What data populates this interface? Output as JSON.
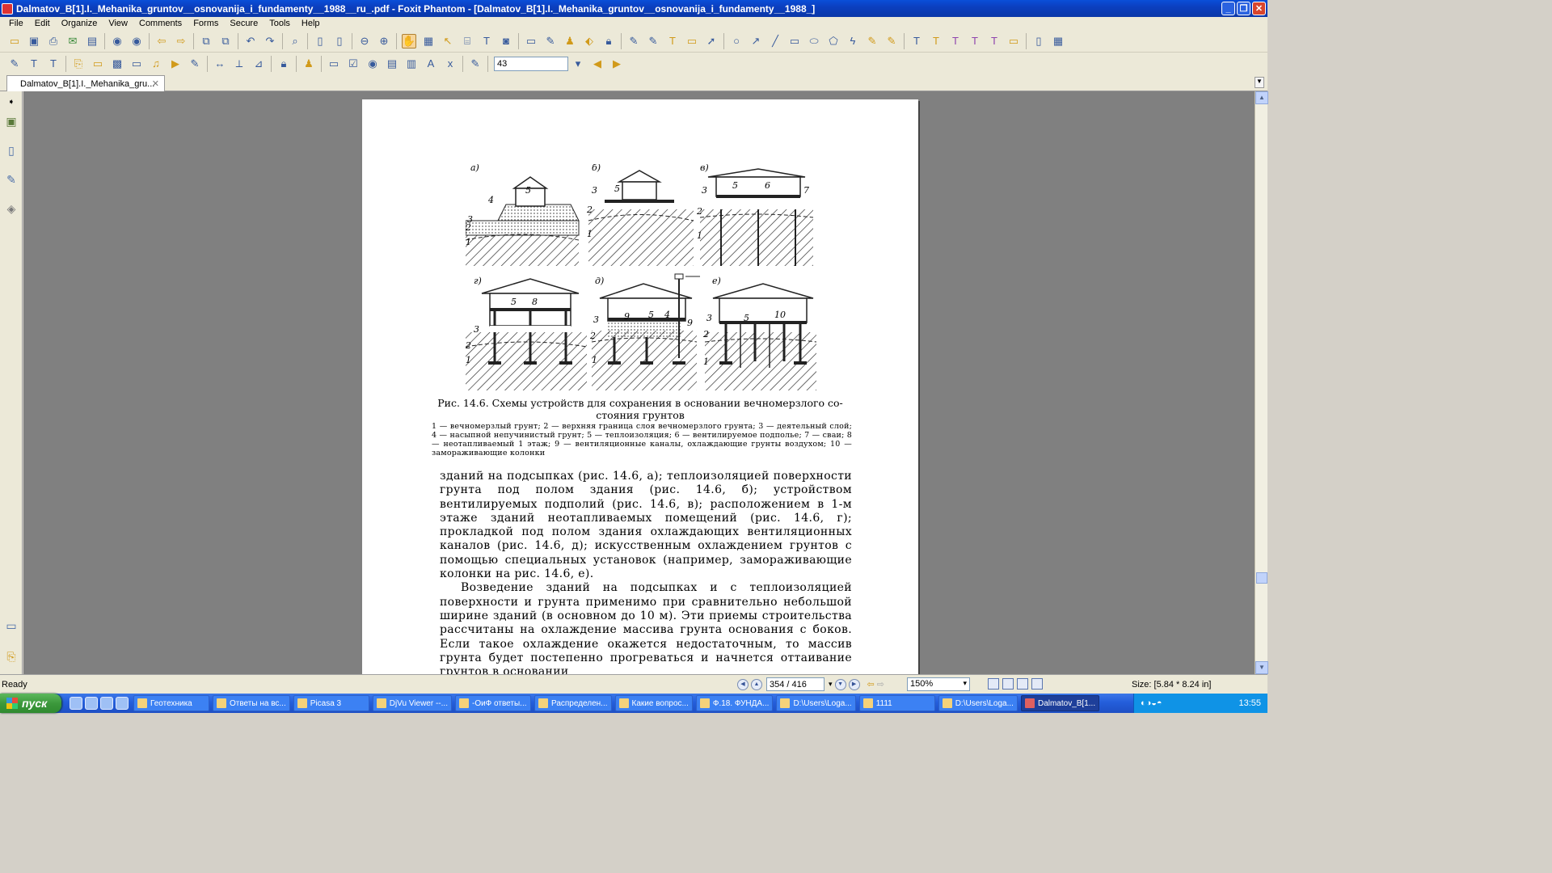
{
  "window": {
    "title": "Dalmatov_B[1].I._Mehanika_gruntov__osnovanija_i_fundamenty__1988__ru_.pdf - Foxit Phantom - [Dalmatov_B[1].I._Mehanika_gruntov__osnovanija_i_fundamenty__1988_]"
  },
  "menu": [
    "File",
    "Edit",
    "Organize",
    "View",
    "Comments",
    "Forms",
    "Secure",
    "Tools",
    "Help"
  ],
  "toolbar": {
    "zoom_value": "43"
  },
  "tab": {
    "label": "Dalmatov_B[1].I._Mehanika_gru..."
  },
  "page": {
    "figure": {
      "panels": [
        "а)",
        "б)",
        "в)",
        "г)",
        "д)",
        "е)"
      ],
      "caption_line1": "Рис. 14.6. Схемы устройств для сохранения в основании вечномерзлого со-",
      "caption_line2": "стояния грунтов",
      "legend": "1 — вечномерзлый грунт; 2 — верхняя граница слоя вечномерзлого грунта; 3 — деятельный слой; 4 — насыпной непучинистый грунт; 5 — теплоизоляция; 6 — вентилируемое подполье; 7 — сваи; 8 — неотапливаемый 1 этаж; 9 — вентиляционные каналы, охлаждающие грунты воздухом; 10 — замораживающие колонки"
    },
    "paragraph1": "зданий на подсыпках (рис. 14.6, а); теплоизоляцией поверхности грунта под полом здания (рис. 14.6, б); устройством вентилируемых подполий (рис. 14.6, в); расположением в 1-м этаже зданий неотапливаемых помещений (рис. 14.6, г); прокладкой под полом здания охлаждающих вентиляционных каналов (рис. 14.6, д); искусственным охлаждением грунтов с помощью специальных установок (например, замораживающие колонки на рис. 14.6, е).",
    "paragraph2": "Возведение зданий на подсыпках и с теплоизоляцией поверхности и грунта применимо при сравнительно небольшой ширине зданий (в основном до 10 м). Эти приемы строительства рассчитаны на охлаждение массива грунта основания с боков. Если такое охлаждение окажется недостаточным, то массив грунта будет постепенно прогреваться и начнется оттаивание грунтов в основании"
  },
  "status": {
    "ready": "Ready",
    "page_indicator": "354 / 416",
    "zoom": "150%",
    "size": "Size: [5.84 * 8.24 in]"
  },
  "taskbar": {
    "start": "пуск",
    "buttons": [
      "Геотехника",
      "Ответы на вс...",
      "Picasa 3",
      "DjVu Viewer --...",
      "-ОиФ ответы...",
      "Распределен...",
      "Какие вопрос...",
      "Ф.18. ФУНДА...",
      "D:\\Users\\Loga...",
      "1111",
      "D:\\Users\\Loga...",
      "Dalmatov_B[1..."
    ],
    "lang": "EN",
    "clock": "13:55"
  }
}
